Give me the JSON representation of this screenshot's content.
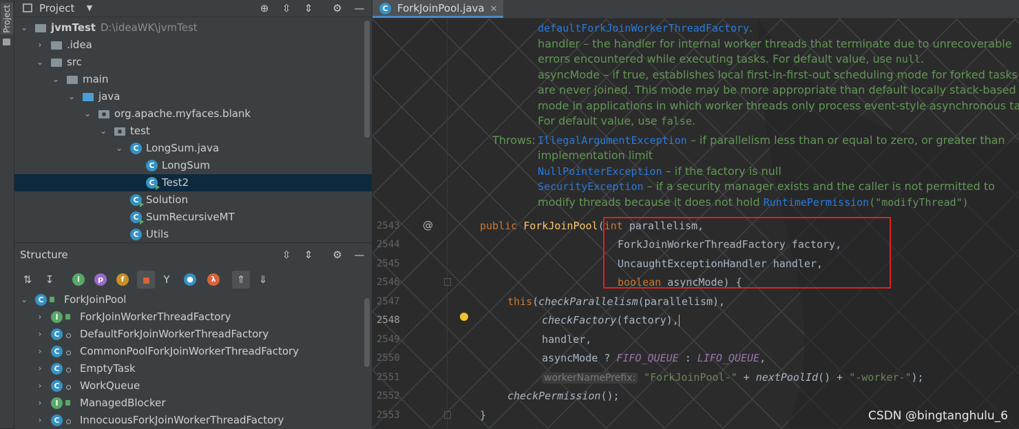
{
  "sidebar_strip": {
    "label": "Project"
  },
  "project": {
    "title": "Project",
    "tree": [
      {
        "label": "jvmTest",
        "path": "D:\\ideaWK\\jvmTest",
        "kind": "folder",
        "depth": 0,
        "expanded": true
      },
      {
        "label": ".idea",
        "kind": "folder",
        "depth": 1,
        "expanded": false
      },
      {
        "label": "src",
        "kind": "folder",
        "depth": 1,
        "expanded": true
      },
      {
        "label": "main",
        "kind": "folder",
        "depth": 2,
        "expanded": true
      },
      {
        "label": "java",
        "kind": "source-folder",
        "depth": 3,
        "expanded": true
      },
      {
        "label": "org.apache.myfaces.blank",
        "kind": "package",
        "depth": 4,
        "expanded": true
      },
      {
        "label": "test",
        "kind": "package",
        "depth": 5,
        "expanded": true
      },
      {
        "label": "LongSum.java",
        "kind": "class",
        "depth": 6,
        "expanded": true
      },
      {
        "label": "LongSum",
        "kind": "class",
        "depth": 7
      },
      {
        "label": "Test2",
        "kind": "class-runnable",
        "depth": 7,
        "selected": true
      },
      {
        "label": "Solution",
        "kind": "class-runnable",
        "depth": 6
      },
      {
        "label": "SumRecursiveMT",
        "kind": "class-runnable",
        "depth": 6
      },
      {
        "label": "Utils",
        "kind": "class",
        "depth": 6
      }
    ]
  },
  "structure": {
    "title": "Structure",
    "filters": [
      "i",
      "p",
      "f",
      "λ"
    ],
    "tree": [
      {
        "label": "ForkJoinPool",
        "kind": "class",
        "depth": 0,
        "expanded": true
      },
      {
        "label": "ForkJoinWorkerThreadFactory",
        "kind": "interface",
        "depth": 1
      },
      {
        "label": "DefaultForkJoinWorkerThreadFactory",
        "kind": "class",
        "depth": 1
      },
      {
        "label": "CommonPoolForkJoinWorkerThreadFactory",
        "kind": "class",
        "depth": 1
      },
      {
        "label": "EmptyTask",
        "kind": "class",
        "depth": 1
      },
      {
        "label": "WorkQueue",
        "kind": "class",
        "depth": 1
      },
      {
        "label": "ManagedBlocker",
        "kind": "interface",
        "depth": 1
      },
      {
        "label": "InnocuousForkJoinWorkerThreadFactory",
        "kind": "class",
        "depth": 1
      }
    ]
  },
  "editor": {
    "tab": "ForkJoinPool.java",
    "doc": {
      "l1_link": "defaultForkJoinWorkerThreadFactory",
      "l1_tail": ".",
      "l2": "handler – the handler for internal worker threads that terminate due to unrecoverable",
      "l3_a": "errors encountered while executing tasks. For default value, use ",
      "l3_code": "null",
      "l3_b": ".",
      "l4": "asyncMode – if true, establishes local first-in-first-out scheduling mode for forked tasks that",
      "l5": "are never joined. This mode may be more appropriate than default locally stack-based",
      "l6": "mode in applications in which worker threads only process event-style asynchronous tasks.",
      "l7_a": "For default value, use ",
      "l7_code": "false",
      "l7_b": ".",
      "throws_label": "Throws:",
      "t1_link": "IllegalArgumentException",
      "t1_text": " – if parallelism less than or equal to zero, or greater than",
      "t1b": "implementation limit",
      "t2_link": "NullPointerException",
      "t2_text": " – if the factory is null",
      "t3_link": "SecurityException",
      "t3_text": " – if a security manager exists and the caller is not permitted to",
      "t4_a": "modify threads because it does not hold ",
      "t4_link": "RuntimePermission",
      "t4_code": "(\"modifyThread\")"
    },
    "gutter_at": "@",
    "line_numbers": [
      "2543",
      "2544",
      "2545",
      "2546",
      "2547",
      "2548",
      "2549",
      "2550",
      "2551",
      "2552",
      "2553"
    ],
    "current_line": "2548",
    "code": {
      "l2543_kw": "public",
      "l2543_name": "ForkJoinPool",
      "l2543_p": "(",
      "l2543_type": "int",
      "l2543_rest": " parallelism,",
      "l2544": "ForkJoinWorkerThreadFactory factory,",
      "l2545": "UncaughtExceptionHandler handler,",
      "l2546_kw": "boolean",
      "l2546_rest": " asyncMode) {",
      "l2547_kw": "this",
      "l2547_p1": "(",
      "l2547_fn": "checkParallelism",
      "l2547_rest": "(parallelism),",
      "l2548_fn": "checkFactory",
      "l2548_rest": "(factory),",
      "l2549": "handler,",
      "l2550_a": "asyncMode ? ",
      "l2550_c1": "FIFO_QUEUE",
      "l2550_b": " : ",
      "l2550_c2": "LIFO_QUEUE",
      "l2550_tail": ",",
      "l2551_hint": "workerNamePrefix:",
      "l2551_s1": "\"ForkJoinPool-\"",
      "l2551_a": " + ",
      "l2551_fn": "nextPoolId",
      "l2551_b": "() + ",
      "l2551_s2": "\"-worker-\"",
      "l2551_tail": ");",
      "l2552_fn": "checkPermission",
      "l2552_rest": "();",
      "l2553": "}"
    }
  },
  "watermark": "CSDN @bingtanghulu_6",
  "colors": {
    "accent": "#4a88c7",
    "highlight_box": "#e1201e",
    "selection": "#0d293e"
  }
}
